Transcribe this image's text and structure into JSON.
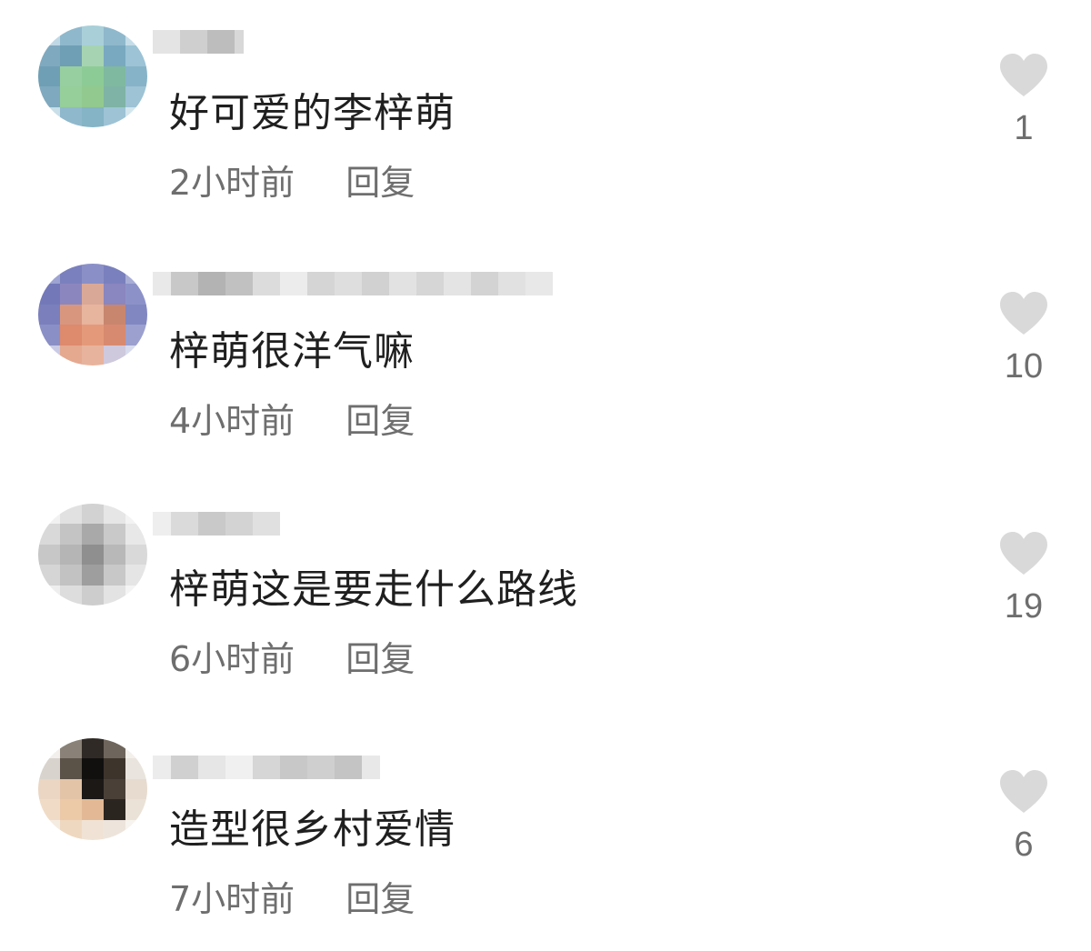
{
  "comments": [
    {
      "text": "好可爱的李梓萌",
      "time": "2小时前",
      "reply": "回复",
      "likes": "1",
      "icon": "heart-icon"
    },
    {
      "text": "梓萌很洋气嘛",
      "time": "4小时前",
      "reply": "回复",
      "likes": "10",
      "icon": "heart-icon"
    },
    {
      "text": "梓萌这是要走什么路线",
      "time": "6小时前",
      "reply": "回复",
      "likes": "19",
      "icon": "heart-icon"
    },
    {
      "text": "造型很乡村爱情",
      "time": "7小时前",
      "reply": "回复",
      "likes": "6",
      "icon": "heart-icon"
    }
  ],
  "colors": {
    "heart": "#d9d9d9",
    "meta_text": "#6e6e6e",
    "comment_text": "#1f1f1f"
  }
}
